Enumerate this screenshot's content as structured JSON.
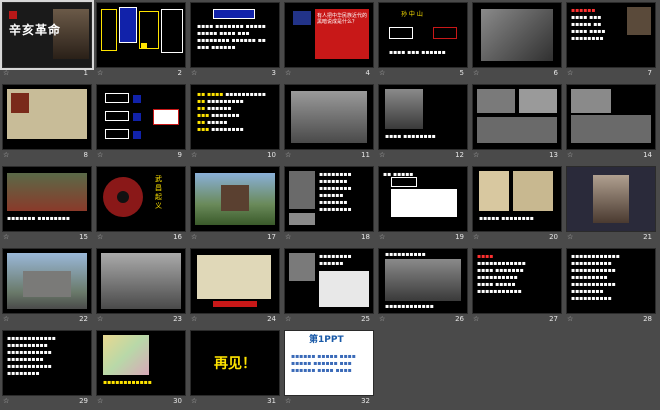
{
  "slides": [
    {
      "number": "1",
      "title": "辛亥革命",
      "selected": true
    },
    {
      "number": "2"
    },
    {
      "number": "3"
    },
    {
      "number": "4",
      "text": "有人把中华民族近代的黑暗说成是什么？"
    },
    {
      "number": "5",
      "text": "孙 中 山"
    },
    {
      "number": "6"
    },
    {
      "number": "7"
    },
    {
      "number": "8"
    },
    {
      "number": "9"
    },
    {
      "number": "10"
    },
    {
      "number": "11"
    },
    {
      "number": "12"
    },
    {
      "number": "13"
    },
    {
      "number": "14"
    },
    {
      "number": "15"
    },
    {
      "number": "16",
      "text": "武昌起义"
    },
    {
      "number": "17"
    },
    {
      "number": "18"
    },
    {
      "number": "19"
    },
    {
      "number": "20"
    },
    {
      "number": "21"
    },
    {
      "number": "22"
    },
    {
      "number": "23"
    },
    {
      "number": "24"
    },
    {
      "number": "25"
    },
    {
      "number": "26"
    },
    {
      "number": "27"
    },
    {
      "number": "28"
    },
    {
      "number": "29"
    },
    {
      "number": "30"
    },
    {
      "number": "31",
      "text": "再见！"
    },
    {
      "number": "32",
      "text": "第1PPT"
    }
  ],
  "icons": {
    "transition": "star-icon"
  }
}
